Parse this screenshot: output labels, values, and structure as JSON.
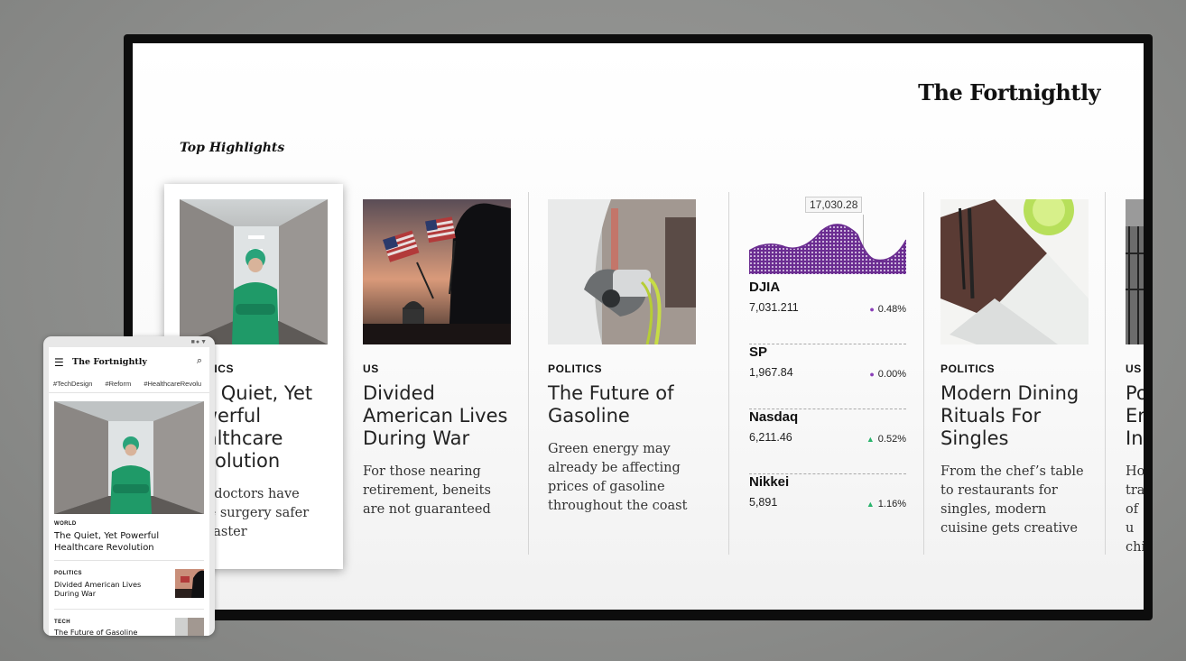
{
  "brand": "The Fortnightly",
  "section_title": "Top Highlights",
  "cards": [
    {
      "category": "POLITICS",
      "headline": "The Quiet, Yet Powerful Healthcare Revolution",
      "dek": "New doctors have made surgery safer and faster"
    },
    {
      "category": "US",
      "headline": "Divided American Lives During War",
      "dek": "For those nearing retirement, beneits are not guaranteed"
    },
    {
      "category": "POLITICS",
      "headline": "The Future of Gasoline",
      "dek": "Green energy may already be affecting prices of gasoline throughout the coast"
    },
    {
      "category": "POLITICS",
      "headline": "Modern Dining Rituals For Singles",
      "dek": "From the chef’s table to restaurants for singles, modern cuisine gets creative"
    },
    {
      "category": "US",
      "headline": "Po En In",
      "dek": "Ho tra of u chi"
    }
  ],
  "market": {
    "tooltip": "17,030.28",
    "stocks": [
      {
        "name": "DJIA",
        "value": "7,031.211",
        "change": "0.48%",
        "color": "#8a3fb8"
      },
      {
        "name": "SP",
        "value": "1,967.84",
        "change": "0.00%",
        "color": "#8a3fb8"
      },
      {
        "name": "Nasdaq",
        "value": "6,211.46",
        "change": "0.52%",
        "color": "#29b36b"
      },
      {
        "name": "Nikkei",
        "value": "5,891",
        "change": "1.16%",
        "color": "#29b36b"
      }
    ]
  },
  "phone": {
    "brand": "The Fortnightly",
    "tags": [
      "#TechDesign",
      "#Reform",
      "#HealthcareRevolu"
    ],
    "story1": {
      "category": "WORLD",
      "title": "The Quiet, Yet Powerful Healthcare Revolution"
    },
    "story2": {
      "category": "POLITICS",
      "title": "Divided American Lives During War"
    },
    "story3": {
      "category": "TECH",
      "title": "The Future of Gasoline"
    }
  },
  "colors": {
    "accent_purple": "#6b2d91",
    "up_green": "#29b36b"
  }
}
